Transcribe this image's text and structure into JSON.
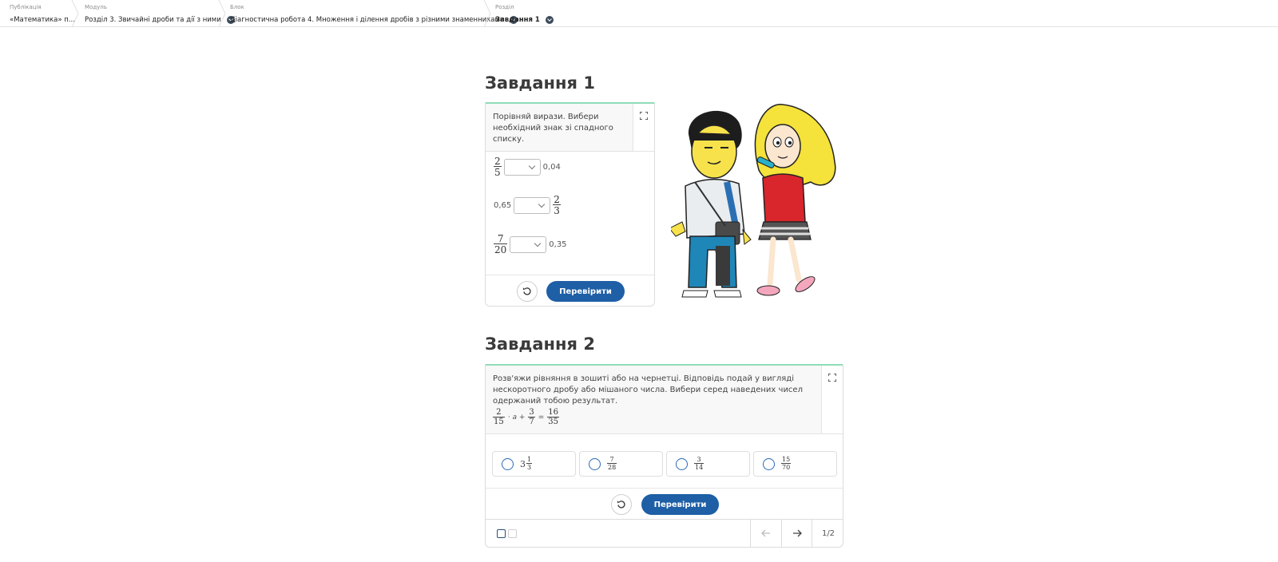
{
  "breadcrumb": [
    {
      "caption": "Публікація",
      "value": "«Математика» п..."
    },
    {
      "caption": "Модуль",
      "value": "Розділ 3. Звичайні дроби та дії з ними"
    },
    {
      "caption": "Блок",
      "value": "Діагностична робота 4. Множення і ділення дробів з різними знаменниками"
    },
    {
      "caption": "Розділ",
      "value": "Завдання 1"
    }
  ],
  "task1": {
    "title": "Завдання 1",
    "question": "Порівняй вирази. Вибери необхідний знак зі спадного списку.",
    "rows": [
      {
        "left_num": "2",
        "left_den": "5",
        "right": "0,04"
      },
      {
        "left": "0,65",
        "right_num": "2",
        "right_den": "3"
      },
      {
        "left_num": "7",
        "left_den": "20",
        "right": "0,35"
      }
    ],
    "check_label": "Перевірити"
  },
  "task2": {
    "title": "Завдання 2",
    "question": "Розв'яжи рівняння в зошиті або на чернетці. Відповідь подай у вигляді нескоротного дробу або мішаного числа. Вибери серед наведених чисел одержаний тобою результат.",
    "equation": {
      "f1_num": "2",
      "f1_den": "15",
      "op1": "· a +",
      "f2_num": "3",
      "f2_den": "7",
      "eq": "=",
      "f3_num": "16",
      "f3_den": "35"
    },
    "options": [
      {
        "whole": "3",
        "num": "1",
        "den": "3"
      },
      {
        "num": "7",
        "den": "28"
      },
      {
        "num": "3",
        "den": "14"
      },
      {
        "num": "15",
        "den": "70"
      }
    ],
    "check_label": "Перевірити",
    "page_indicator": "1/2"
  },
  "colors": {
    "accent": "#1e5fa6",
    "card_top": "#8fdcb7"
  }
}
